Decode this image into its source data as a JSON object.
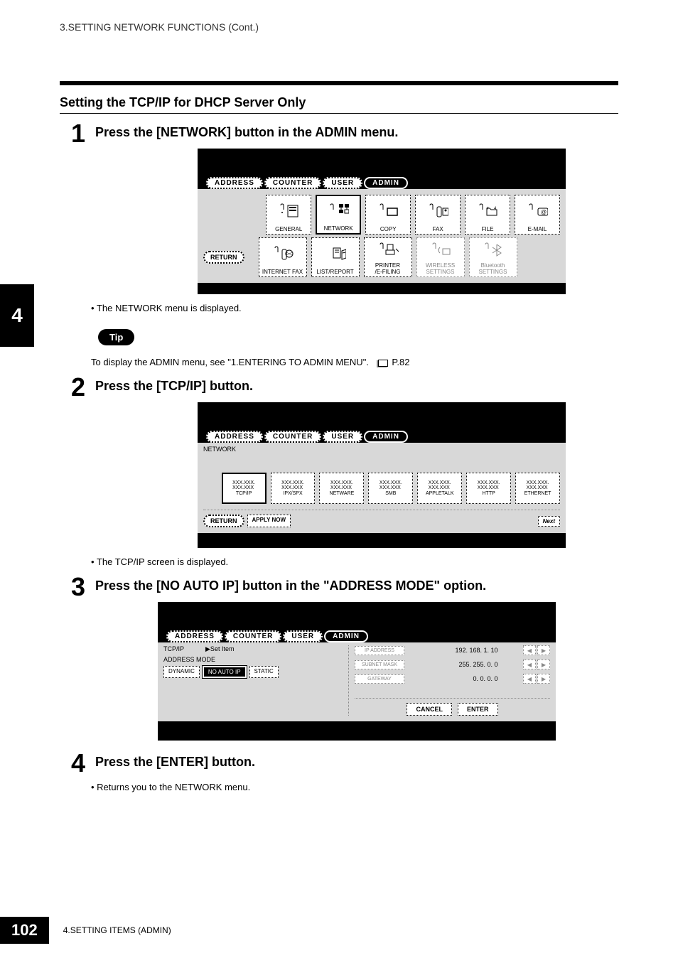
{
  "header": {
    "chapter_text": "3.SETTING NETWORK FUNCTIONS (Cont.)"
  },
  "section": {
    "title": "Setting the TCP/IP for DHCP Server Only"
  },
  "side_tab": "4",
  "steps": {
    "s1": {
      "num": "1",
      "title": "Press the [NETWORK] button in the ADMIN menu.",
      "bullet": "The NETWORK menu is displayed."
    },
    "s2": {
      "num": "2",
      "title": "Press the [TCP/IP] button.",
      "bullet": "The TCP/IP screen is displayed."
    },
    "s3": {
      "num": "3",
      "title": "Press the [NO AUTO IP] button in the \"ADDRESS MODE\" option."
    },
    "s4": {
      "num": "4",
      "title": "Press the [ENTER] button.",
      "bullet": "Returns you to the NETWORK menu."
    }
  },
  "tip": {
    "badge": "Tip",
    "text_pre": "To display the ADMIN menu, see \"1.ENTERING TO ADMIN MENU\".",
    "page_ref": "P.82"
  },
  "screen1": {
    "tabs": {
      "address": "ADDRESS",
      "counter": "COUNTER",
      "user": "USER",
      "admin": "ADMIN"
    },
    "icons": {
      "general": "GENERAL",
      "network": "NETWORK",
      "copy": "COPY",
      "fax": "FAX",
      "file": "FILE",
      "email": "E-MAIL",
      "internet_fax": "INTERNET FAX",
      "list_report": "LIST/REPORT",
      "printer_efiling": "PRINTER\n/E-FILING",
      "wireless": "WIRELESS\nSETTINGS",
      "bluetooth": "Bluetooth\nSETTINGS"
    },
    "return": "RETURN"
  },
  "screen2": {
    "tabs": {
      "address": "ADDRESS",
      "counter": "COUNTER",
      "user": "USER",
      "admin": "ADMIN"
    },
    "header_label": "NETWORK",
    "buttons": {
      "tcpip": "TCP/IP",
      "ipxspx": "IPX/SPX",
      "netware": "NETWARE",
      "smb": "SMB",
      "appletalk": "APPLETALK",
      "http": "HTTP",
      "ethernet": "ETHERNET"
    },
    "placeholder": "XXX.XXX.\nXXX.XXX",
    "return": "RETURN",
    "apply_now": "APPLY NOW",
    "next": "Next"
  },
  "screen3": {
    "tabs": {
      "address": "ADDRESS",
      "counter": "COUNTER",
      "user": "USER",
      "admin": "ADMIN"
    },
    "left_header": {
      "path": "TCP/IP",
      "set_item": "▶Set Item"
    },
    "address_mode": "ADDRESS MODE",
    "modes": {
      "dynamic": "DYNAMIC",
      "no_auto_ip": "NO AUTO IP",
      "static": "STATIC"
    },
    "rows": {
      "ip_address": {
        "label": "IP ADDRESS",
        "value": "192. 168.    1.  10"
      },
      "subnet": {
        "label": "SUBNET MASK",
        "value": "255. 255.    0.    0"
      },
      "gateway": {
        "label": "GATEWAY",
        "value": "0.    0.    0.    0"
      }
    },
    "cancel": "CANCEL",
    "enter": "ENTER"
  },
  "footer": {
    "page_num": "102",
    "text": "4.SETTING ITEMS (ADMIN)"
  }
}
